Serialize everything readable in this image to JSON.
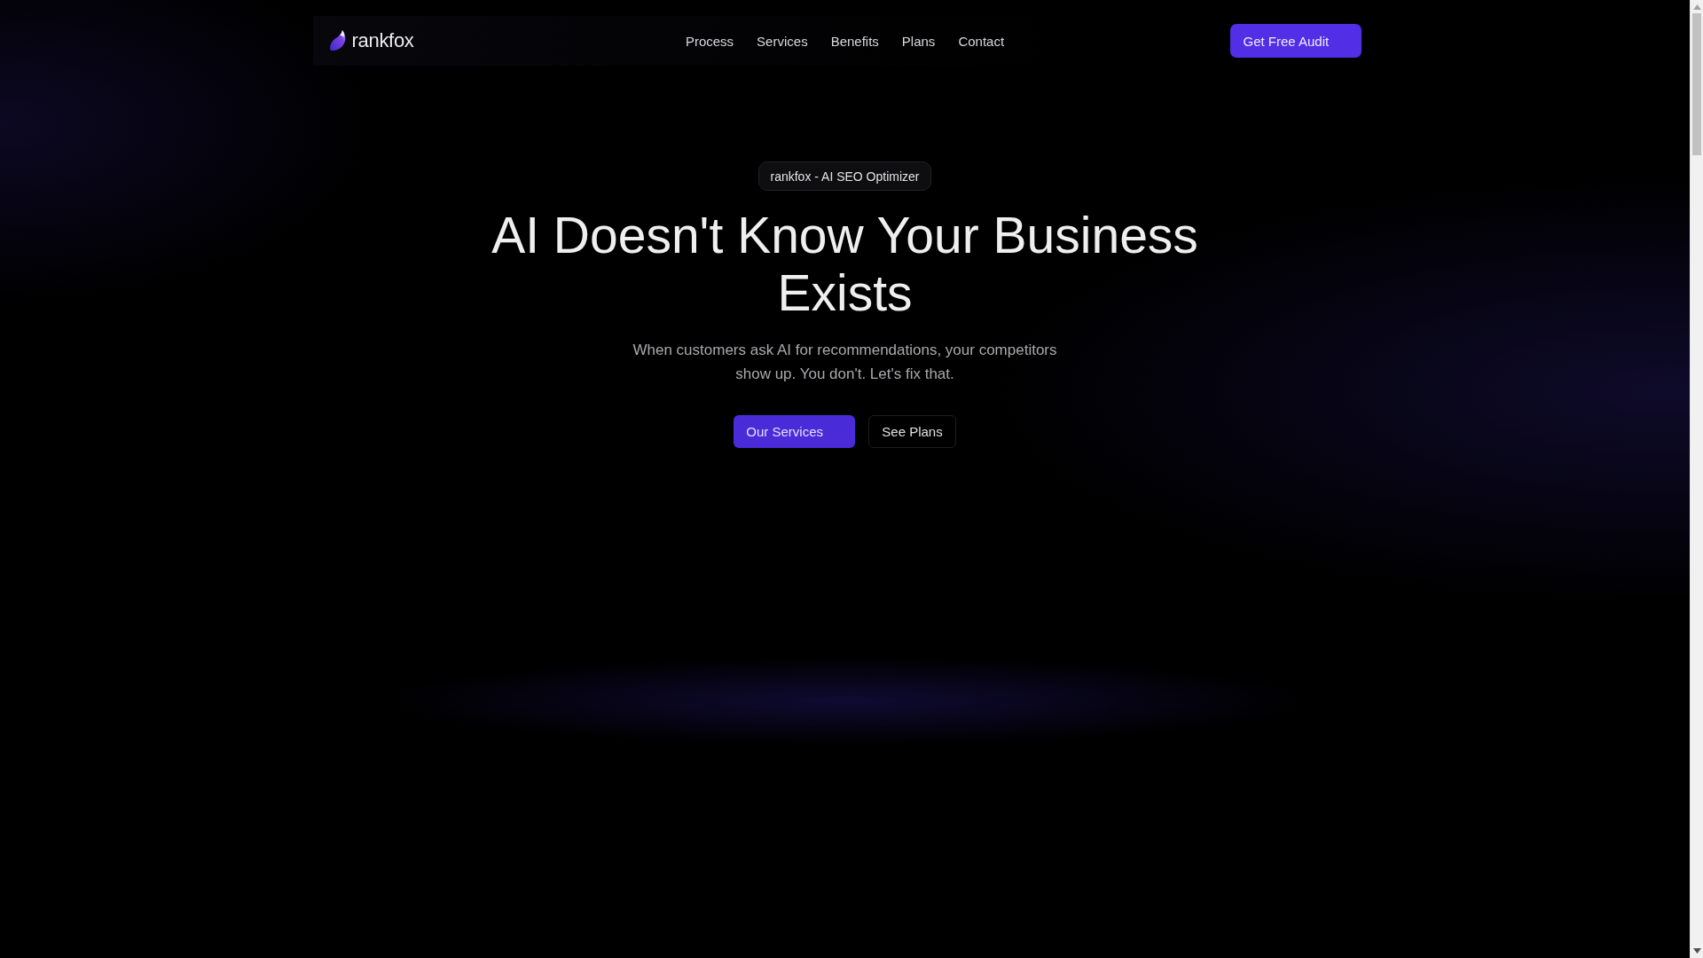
{
  "nav": {
    "brand": "rankfox",
    "links": [
      "Process",
      "Services",
      "Benefits",
      "Plans",
      "Contact"
    ],
    "cta": "Get Free Audit"
  },
  "hero": {
    "badge": "rankfox - AI SEO Optimizer",
    "title": "AI Doesn't Know Your Business Exists",
    "subtitle": "When customers ask AI for recommendations, your competitors show up. You don't. Let's fix that.",
    "buttons": [
      {
        "label": "Our Services",
        "kind": "primary"
      },
      {
        "label": "See Plans",
        "kind": "secondary"
      }
    ]
  }
}
